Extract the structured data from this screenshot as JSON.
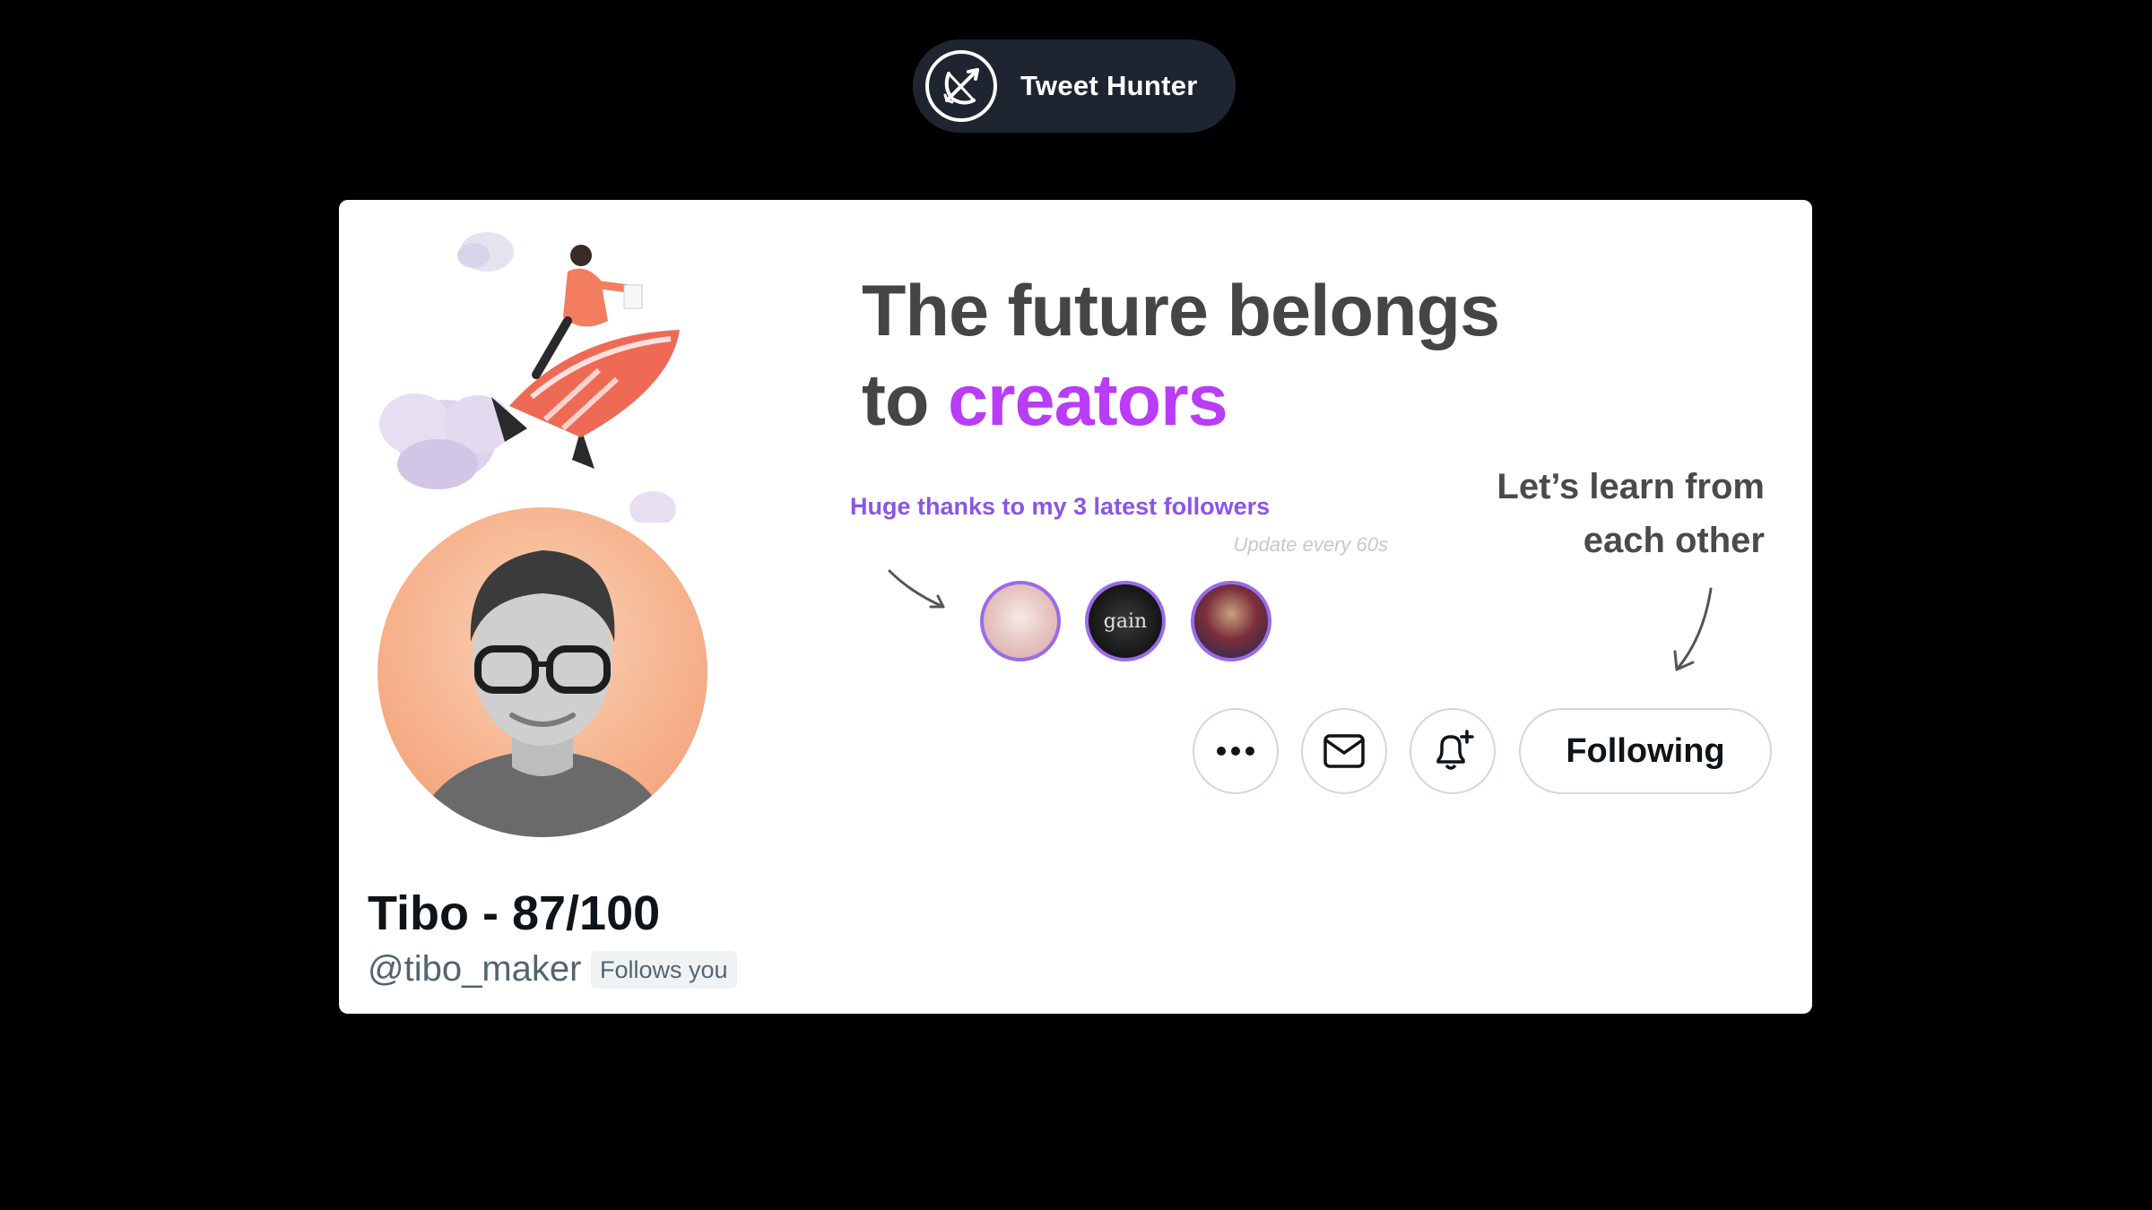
{
  "brand": {
    "name": "Tweet Hunter",
    "logo_icon": "bow-and-arrow-icon"
  },
  "banner": {
    "headline_line1": "The future belongs",
    "headline_line2_prefix": "to ",
    "headline_line2_accent": "creators",
    "thanks_text": "Huge thanks to my 3 latest followers",
    "update_note": "Update every 60s",
    "learn_line1": "Let’s learn from",
    "learn_line2": "each other",
    "followers": [
      {
        "label": ""
      },
      {
        "label": "gain"
      },
      {
        "label": ""
      }
    ],
    "colors": {
      "accent": "#b93cf6",
      "thanks": "#8a55e6"
    }
  },
  "profile": {
    "display_name": "Tibo - 87/100",
    "handle": "@tibo_maker",
    "follows_you": "Follows you"
  },
  "actions": {
    "more_icon": "more-icon",
    "dm_icon": "mail-icon",
    "notify_icon": "bell-plus-icon",
    "following_label": "Following"
  }
}
